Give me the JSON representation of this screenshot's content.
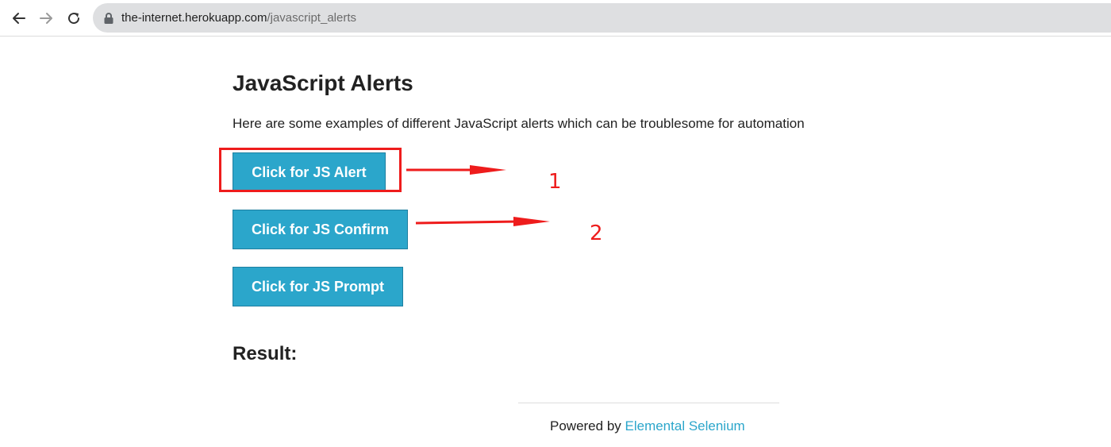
{
  "browser": {
    "url_host": "the-internet.herokuapp.com",
    "url_path": "/javascript_alerts",
    "back_icon": "arrow-left-icon",
    "forward_icon": "arrow-right-icon",
    "reload_icon": "reload-icon",
    "lock_icon": "lock-icon"
  },
  "page": {
    "title": "JavaScript Alerts",
    "intro": "Here are some examples of different JavaScript alerts which can be troublesome for automation",
    "buttons": {
      "alert": "Click for JS Alert",
      "confirm": "Click for JS Confirm",
      "prompt": "Click for JS Prompt"
    },
    "result_heading": "Result:",
    "result_value": ""
  },
  "footer": {
    "prefix": "Powered by ",
    "link": "Elemental Selenium"
  },
  "annotations": {
    "label_1": "1",
    "label_2": "2",
    "color": "#ee1c1c"
  },
  "colors": {
    "button_bg": "#2ba6cb",
    "link": "#2ba6cb"
  }
}
